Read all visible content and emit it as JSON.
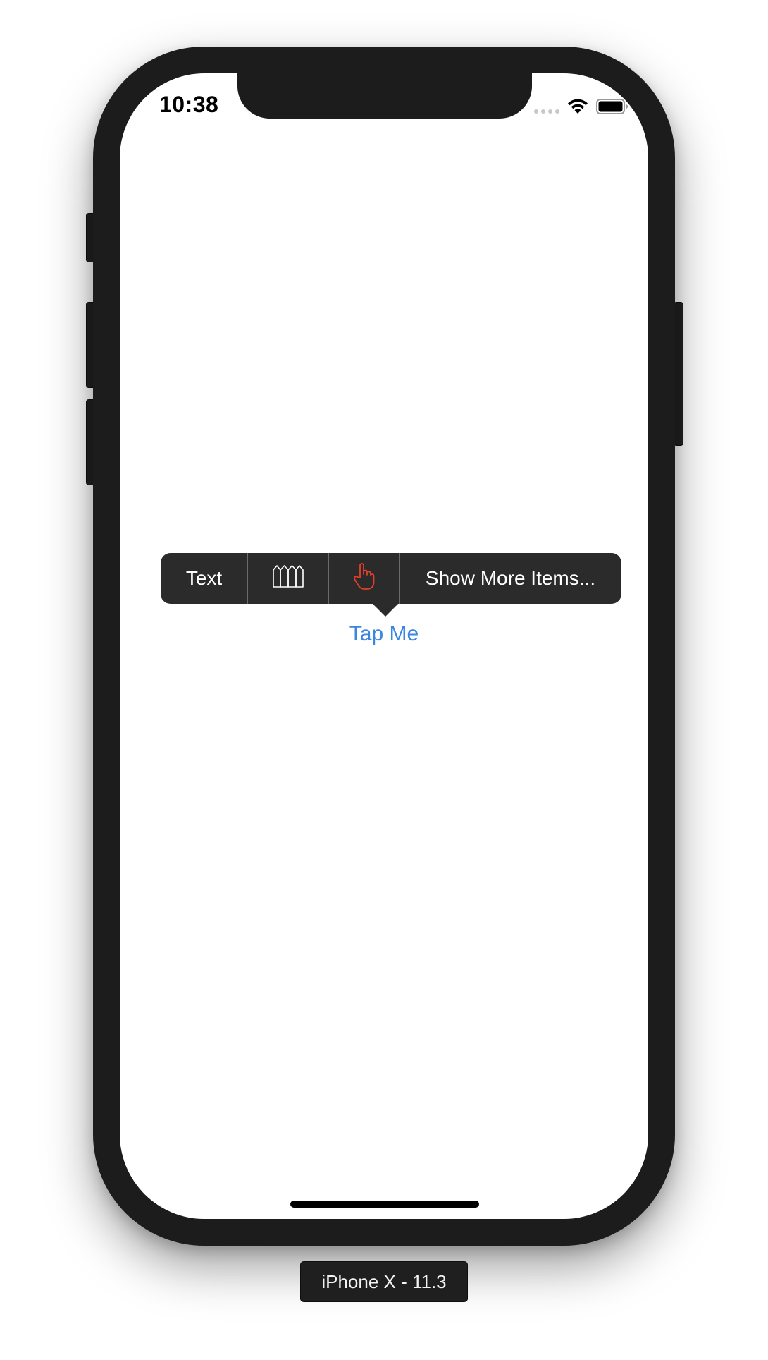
{
  "status_bar": {
    "time": "10:38",
    "icons": [
      "signal-dots-icon",
      "wifi-icon",
      "battery-icon"
    ]
  },
  "edit_menu": {
    "items": [
      {
        "type": "text",
        "label": "Text"
      },
      {
        "type": "icon",
        "icon": "fence-icon"
      },
      {
        "type": "icon",
        "icon": "hand-pointer-icon",
        "color": "#e0402a"
      },
      {
        "type": "text",
        "label": "Show More Items..."
      }
    ]
  },
  "main": {
    "tap_button_label": "Tap Me",
    "tap_button_color": "#3a86e0"
  },
  "device_label": "iPhone X - 11.3"
}
